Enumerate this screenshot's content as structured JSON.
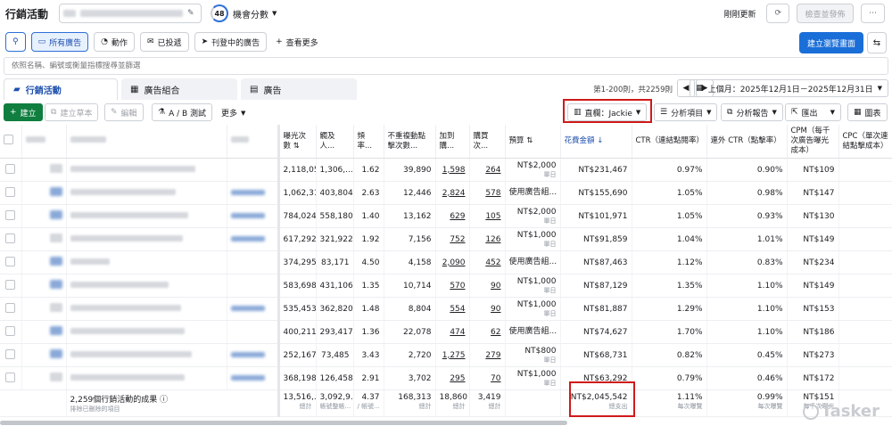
{
  "app": {
    "title": "行銷活動",
    "opportunity_score": "48",
    "opportunity_label": "機會分數",
    "recently_updated": "剛剛更新",
    "review_publish": "檢查並發佈"
  },
  "actions": {
    "all_ads": "所有廣告",
    "activities": "動作",
    "delivered": "已投遞",
    "active_ads": "刊登中的廣告",
    "view_more": "查看更多",
    "create_view": "建立瀏覽畫面"
  },
  "search": {
    "placeholder": "依照名稱、編號或衡量指標搜尋並篩選"
  },
  "tabs": {
    "campaigns": "行銷活動",
    "adsets": "廣告組合",
    "ads": "廣告"
  },
  "pagination": {
    "range": "第1-200則，共2259則",
    "date_range": "上個月：2025年12月1日－2025年12月31日"
  },
  "toolbar": {
    "create": "建立",
    "duplicate_draft": "建立草本",
    "edit": "編輯",
    "ab_test": "A / B 測試",
    "more": "更多",
    "columns": "直欄：Jackie",
    "breakdown": "分析項目",
    "reports": "分析報告",
    "export": "匯出",
    "charts": "圖表"
  },
  "columns": {
    "impressions": "曝光次數",
    "reach": "觸及人...",
    "frequency": "頻率...",
    "unique_link_clicks": "不重複動點擊次數...",
    "add_to_cart": "加到購...",
    "purchases": "購買次...",
    "budget": "預算",
    "amount_spent": "花費金額",
    "ctr": "CTR（連結點閱率）",
    "outbound_ctr": "連外 CTR（點擊率）",
    "cpm": "CPM（每千次廣告曝光成本）",
    "cpc": "CPC（單次連結點擊成本）"
  },
  "rows": [
    {
      "impressions": "2,118,056",
      "reach": "1,306,...",
      "frequency": "1.62",
      "unique_clicks": "39,890",
      "add_to_cart": "1,598",
      "purchases": "264",
      "budget": "NT$2,000",
      "budget_sub": "單日",
      "spent": "NT$231,467",
      "ctr": "0.97%",
      "outbound_ctr": "0.90%",
      "cpm": "NT$109"
    },
    {
      "impressions": "1,062,318",
      "reach": "403,804",
      "frequency": "2.63",
      "unique_clicks": "12,446",
      "add_to_cart": "2,824",
      "purchases": "578",
      "budget": "使用廣告組...",
      "budget_sub": "",
      "spent": "NT$155,690",
      "ctr": "1.05%",
      "outbound_ctr": "0.98%",
      "cpm": "NT$147"
    },
    {
      "impressions": "784,024",
      "reach": "558,180",
      "frequency": "1.40",
      "unique_clicks": "13,162",
      "add_to_cart": "629",
      "purchases": "105",
      "budget": "NT$2,000",
      "budget_sub": "單日",
      "spent": "NT$101,971",
      "ctr": "1.05%",
      "outbound_ctr": "0.93%",
      "cpm": "NT$130"
    },
    {
      "impressions": "617,292",
      "reach": "321,922",
      "frequency": "1.92",
      "unique_clicks": "7,156",
      "add_to_cart": "752",
      "purchases": "126",
      "budget": "NT$1,000",
      "budget_sub": "單日",
      "spent": "NT$91,859",
      "ctr": "1.04%",
      "outbound_ctr": "1.01%",
      "cpm": "NT$149"
    },
    {
      "impressions": "374,295",
      "reach": "83,171",
      "frequency": "4.50",
      "unique_clicks": "4,158",
      "add_to_cart": "2,090",
      "purchases": "452",
      "budget": "使用廣告組...",
      "budget_sub": "",
      "spent": "NT$87,463",
      "ctr": "1.12%",
      "outbound_ctr": "0.83%",
      "cpm": "NT$234"
    },
    {
      "impressions": "583,698",
      "reach": "431,106",
      "frequency": "1.35",
      "unique_clicks": "10,714",
      "add_to_cart": "570",
      "purchases": "90",
      "budget": "NT$1,000",
      "budget_sub": "單日",
      "spent": "NT$87,129",
      "ctr": "1.35%",
      "outbound_ctr": "1.10%",
      "cpm": "NT$149"
    },
    {
      "impressions": "535,453",
      "reach": "362,820",
      "frequency": "1.48",
      "unique_clicks": "8,804",
      "add_to_cart": "554",
      "purchases": "90",
      "budget": "NT$1,000",
      "budget_sub": "單日",
      "spent": "NT$81,887",
      "ctr": "1.29%",
      "outbound_ctr": "1.10%",
      "cpm": "NT$153"
    },
    {
      "impressions": "400,211",
      "reach": "293,417",
      "frequency": "1.36",
      "unique_clicks": "22,078",
      "add_to_cart": "474",
      "purchases": "62",
      "budget": "使用廣告組...",
      "budget_sub": "",
      "spent": "NT$74,627",
      "ctr": "1.70%",
      "outbound_ctr": "1.10%",
      "cpm": "NT$186"
    },
    {
      "impressions": "252,167",
      "reach": "73,485",
      "frequency": "3.43",
      "unique_clicks": "2,720",
      "add_to_cart": "1,275",
      "purchases": "279",
      "budget": "NT$800",
      "budget_sub": "單日",
      "spent": "NT$68,731",
      "ctr": "0.82%",
      "outbound_ctr": "0.45%",
      "cpm": "NT$273"
    },
    {
      "impressions": "368,198",
      "reach": "126,458",
      "frequency": "2.91",
      "unique_clicks": "3,702",
      "add_to_cart": "295",
      "purchases": "70",
      "budget": "NT$1,000",
      "budget_sub": "單日",
      "spent": "NT$63,292",
      "ctr": "0.79%",
      "outbound_ctr": "0.46%",
      "cpm": "NT$172"
    }
  ],
  "summary": {
    "title": "2,259個行銷活動的成果",
    "subtitle": "排除已刪除的項目",
    "impressions": "13,516,...",
    "impressions_sub": "總計",
    "reach": "3,092,9...",
    "reach_sub": "帳號整帳...",
    "frequency": "4.37",
    "frequency_sub": "/ 帳號...",
    "unique_clicks": "168,313",
    "unique_clicks_sub": "總計",
    "add_to_cart": "18,860",
    "add_to_cart_sub": "總計",
    "purchases": "3,419",
    "purchases_sub": "總計",
    "spent": "NT$2,045,542",
    "spent_sub": "總支出",
    "ctr": "1.11%",
    "ctr_sub": "每次曝覽",
    "outbound_ctr": "0.99%",
    "outbound_ctr_sub": "每次曝覽",
    "cpm": "NT$151",
    "cpm_sub": "每千次曝光"
  },
  "watermark": "Tasker"
}
